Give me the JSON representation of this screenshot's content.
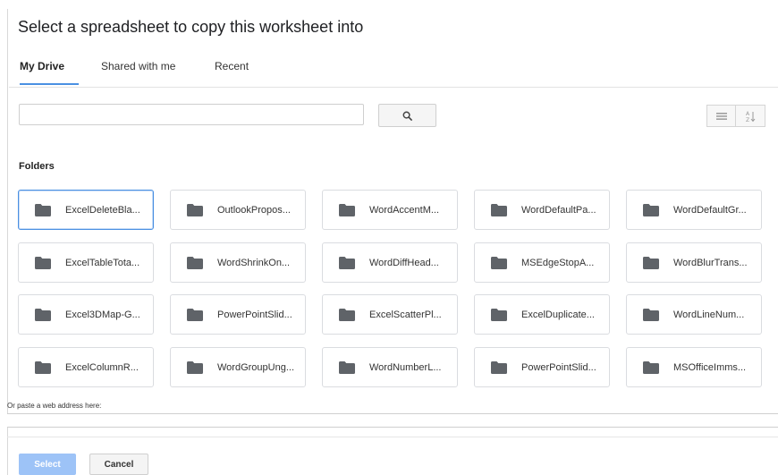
{
  "dialog": {
    "title": "Select a spreadsheet to copy this worksheet into"
  },
  "tabs": [
    {
      "label": "My Drive",
      "active": true
    },
    {
      "label": "Shared with me",
      "active": false
    },
    {
      "label": "Recent",
      "active": false
    }
  ],
  "search": {
    "value": "",
    "button_icon": "search-icon"
  },
  "view_options": {
    "list_icon": "list-view-icon",
    "sort_icon": "sort-az-icon"
  },
  "folders_section": {
    "label": "Folders",
    "items": [
      "ExcelDeleteBla...",
      "OutlookPropos...",
      "WordAccentM...",
      "WordDefaultPa...",
      "WordDefaultGr...",
      "ExcelTableTota...",
      "WordShrinkOn...",
      "WordDiffHead...",
      "MSEdgeStopA...",
      "WordBlurTrans...",
      "Excel3DMap-G...",
      "PowerPointSlid...",
      "ExcelScatterPl...",
      "ExcelDuplicate...",
      "WordLineNum...",
      "ExcelColumnR...",
      "WordGroupUng...",
      "WordNumberL...",
      "PowerPointSlid...",
      "MSOfficeImms..."
    ],
    "selected_index": 0
  },
  "paste": {
    "label": "Or paste a web address here:",
    "value": ""
  },
  "buttons": {
    "select": "Select",
    "cancel": "Cancel"
  },
  "colors": {
    "accent": "#4a90e2",
    "select_button": "#9dc3f7",
    "folder_icon": "#5f6368"
  }
}
